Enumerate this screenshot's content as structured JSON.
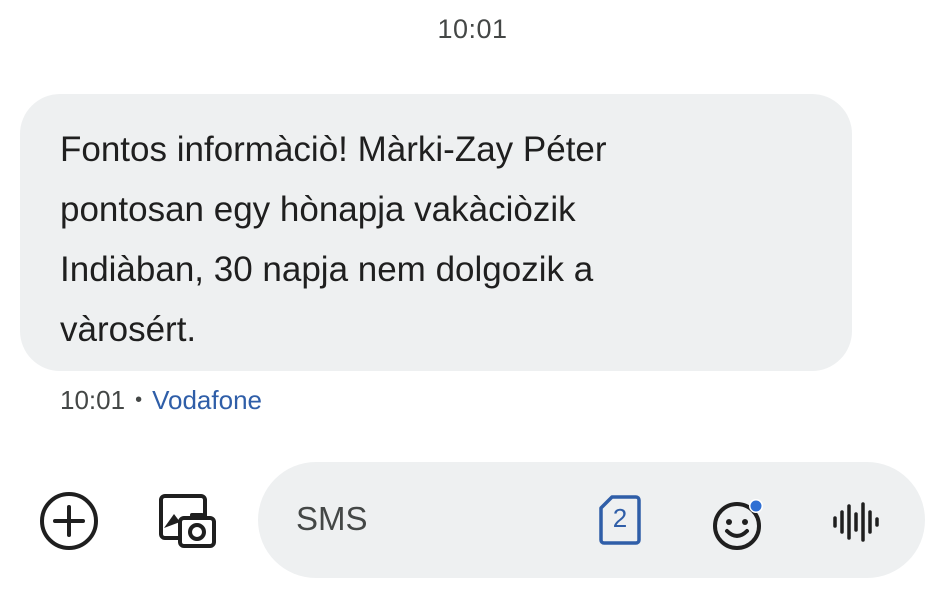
{
  "conversation": {
    "timestamp_header": "10:01"
  },
  "message": {
    "text": "Fontos informàciò! Màrki-Zay Péter\npontosan egy hònapja vakàciòzik\nIndiàban, 30 napja nem dolgozik a\nvàrosért.",
    "time": "10:01",
    "separator": "•",
    "carrier": "Vodafone"
  },
  "composer": {
    "placeholder": "SMS",
    "sim_number": "2"
  },
  "icons": {
    "add": "plus-circle-icon",
    "gallery": "gallery-camera-icon",
    "sim": "sim-card-icon",
    "emoji": "emoji-icon",
    "voice": "voice-waveform-icon"
  },
  "colors": {
    "bubble_bg": "#eef0f1",
    "accent_blue": "#2f5ea8",
    "notification_dot": "#2f6fd3",
    "text_primary": "#1f1f1f",
    "text_secondary": "#444746"
  }
}
